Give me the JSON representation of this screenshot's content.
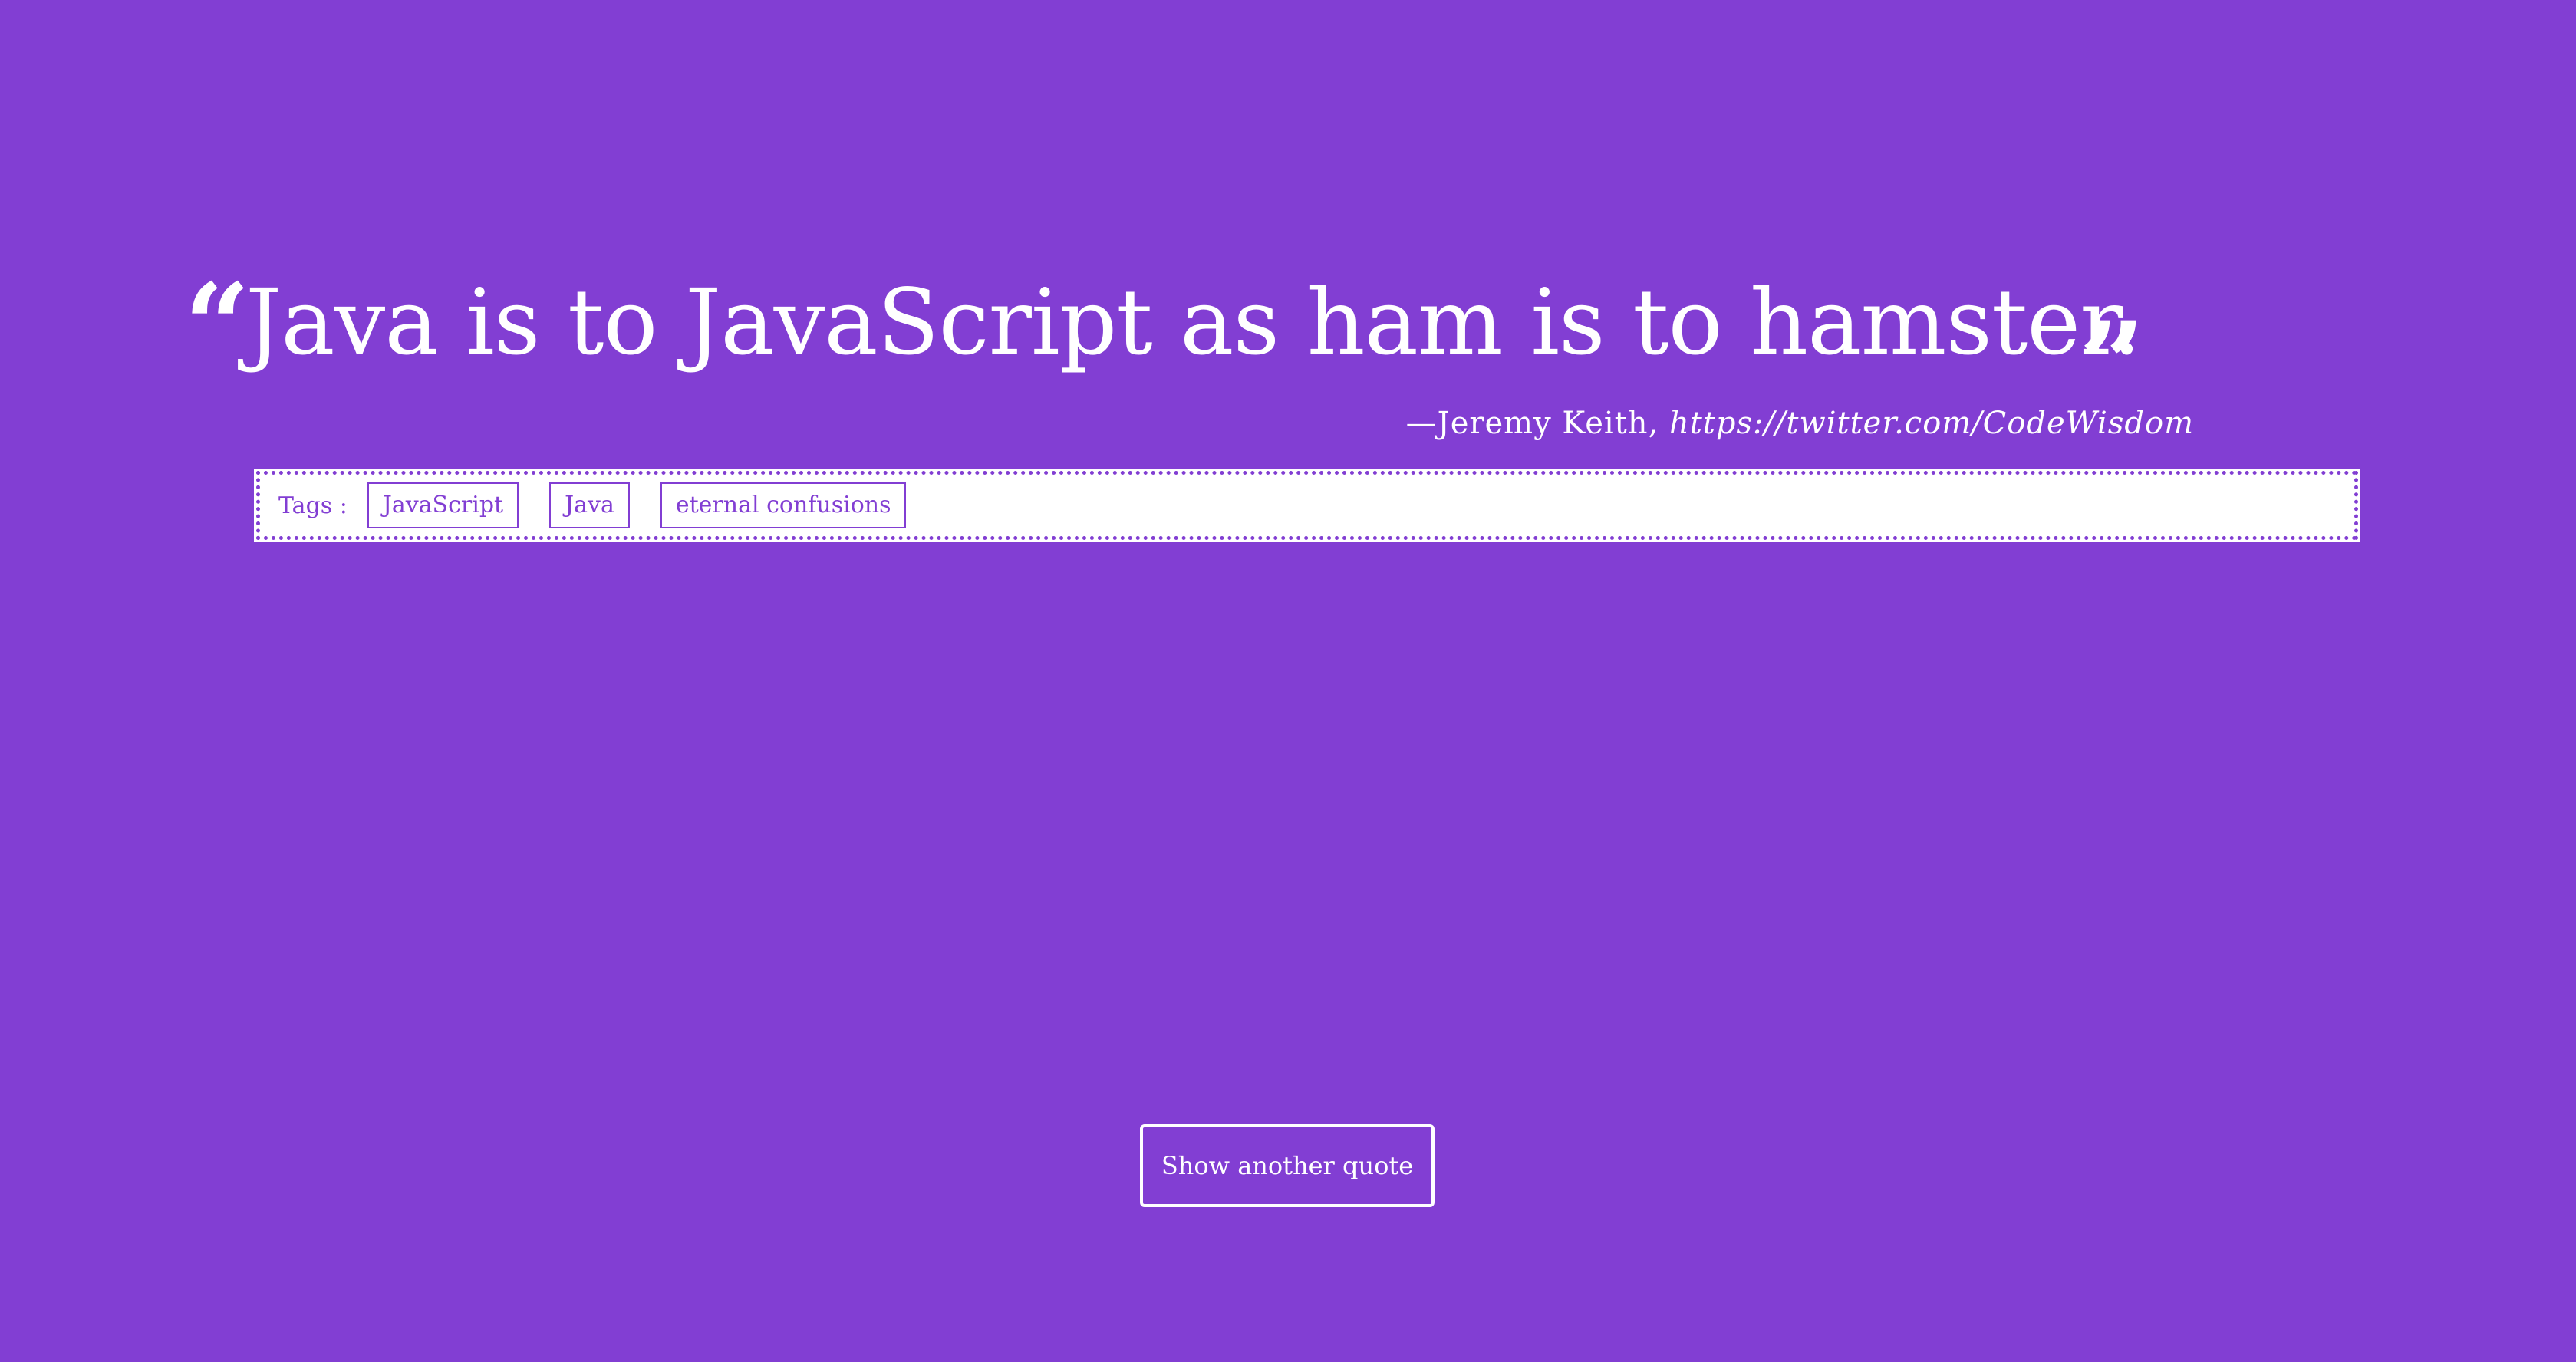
{
  "quote": {
    "open_mark": "“",
    "text": "Java is to JavaScript as ham is to hamster.",
    "close_mark": "”"
  },
  "attribution": {
    "author": "—Jeremy Keith,",
    "source": "https://twitter.com/CodeWisdom"
  },
  "tags": {
    "label": "Tags :",
    "items": [
      "JavaScript",
      "Java",
      "eternal confusions"
    ]
  },
  "actions": {
    "another_label": "Show another quote"
  },
  "colors": {
    "background": "#823ed3",
    "foreground": "#ffffff"
  }
}
